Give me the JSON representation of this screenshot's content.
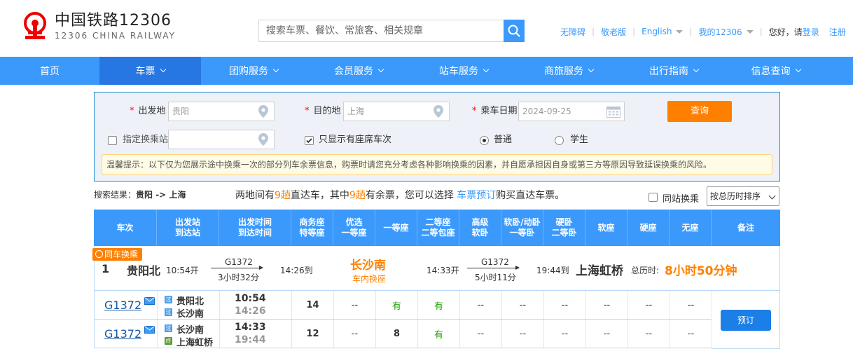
{
  "header": {
    "logo_cn": "中国铁路12306",
    "logo_en": "12306 CHINA RAILWAY",
    "search_placeholder": "搜索车票、餐饮、常旅客、相关规章",
    "links": [
      "无障碍",
      "敬老版",
      "English",
      "我的12306"
    ],
    "greeting": "您好，请",
    "login": "登录",
    "register": "注册"
  },
  "nav": {
    "items": [
      {
        "label": "首页",
        "dropdown": false
      },
      {
        "label": "车票",
        "dropdown": true
      },
      {
        "label": "团购服务",
        "dropdown": true
      },
      {
        "label": "会员服务",
        "dropdown": true
      },
      {
        "label": "站车服务",
        "dropdown": true
      },
      {
        "label": "商旅服务",
        "dropdown": true
      },
      {
        "label": "出行指南",
        "dropdown": true
      },
      {
        "label": "信息查询",
        "dropdown": true
      }
    ],
    "active_index": 1
  },
  "query": {
    "from_label": "出发地",
    "from_value": "贵阳",
    "to_label": "目的地",
    "to_value": "上海",
    "date_label": "乘车日期",
    "date_value": "2024-09-25",
    "query_button": "查询",
    "transfer_label": "指定换乘站",
    "transfer_checked": false,
    "only_seats_label": "只显示有座席车次",
    "only_seats_checked": true,
    "radio_normal": "普通",
    "radio_student": "学生",
    "selected_radio": "普通",
    "notice": "温馨提示：以下仅为您展示途中换乘一次的部分列车余票信息，购票时请您充分考虑各种影响换乘的因素，并自愿承担因自身或第三方等原因导致延误换乘的风险。"
  },
  "results": {
    "summary_prefix": "搜索结果：",
    "summary_route": "贵阳 -> 上海",
    "desc_1": "两地间有",
    "direct_count": "9趟",
    "desc_2": "直达车，其中",
    "avail_count": "9趟",
    "desc_3": "有余票，您可以选择 ",
    "desc_link": "车票预订",
    "desc_4": "购买直达车票。",
    "same_station_label": "同站换乘",
    "same_station_checked": false,
    "sort_label": "按总历时排序"
  },
  "table": {
    "headers": [
      "车次",
      "出发站\n到达站",
      "出发时间\n到达时间",
      "商务座\n特等座",
      "优选\n一等座",
      "一等座",
      "二等座\n二等包座",
      "高级\n软卧",
      "软卧/动卧\n一等卧",
      "硬卧\n二等卧",
      "软座",
      "硬座",
      "无座",
      "备注"
    ],
    "group": {
      "tag": "同车换乘",
      "index": "1",
      "from_station": "贵阳北",
      "dep_time": "10:54开",
      "leg1_train": "G1372",
      "leg1_duration": "3小时32分",
      "leg1_arrive": "14:26到",
      "transfer_station": "长沙南",
      "transfer_note": "车内换座",
      "leg2_depart": "14:33开",
      "leg2_train": "G1372",
      "leg2_duration": "5小时11分",
      "leg2_arrive": "19:44到",
      "to_station": "上海虹桥",
      "total_label": "总历时:",
      "total_time": "8小时50分钟"
    },
    "rows": [
      {
        "train": "G1372",
        "from_station": "贵阳北",
        "from_badge": "过",
        "to_station": "长沙南",
        "to_badge": "过",
        "dep": "10:54",
        "arr": "14:26",
        "seats": [
          "14",
          "--",
          "有",
          "有",
          "--",
          "--",
          "--",
          "--",
          "--",
          "--"
        ]
      },
      {
        "train": "G1372",
        "from_station": "长沙南",
        "from_badge": "过",
        "to_station": "上海虹桥",
        "to_badge": "终",
        "dep": "14:33",
        "arr": "19:44",
        "seats": [
          "12",
          "--",
          "8",
          "有",
          "--",
          "--",
          "--",
          "--",
          "--",
          "--"
        ]
      }
    ],
    "book_button": "预订"
  }
}
